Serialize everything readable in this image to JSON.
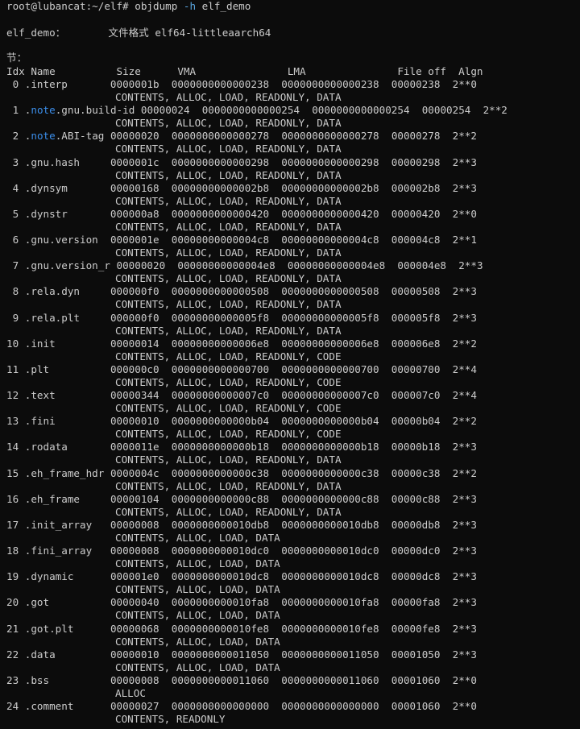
{
  "terminal": {
    "prompt": "root@lubancat:~/elf# ",
    "command": "objdump",
    "flag": "-h",
    "argument": "elf_demo",
    "file_label": "elf_demo：",
    "format_label": "文件格式",
    "format_value": "elf64-littleaarch64",
    "sections_label": "节：",
    "header": {
      "idx": "Idx",
      "name": "Name",
      "size": "Size",
      "vma": "VMA",
      "lma": "LMA",
      "fileoff": "File off",
      "algn": "Algn"
    },
    "rows": [
      {
        "idx": " 0",
        "pre": ".interp",
        "hl": "",
        "post": "",
        "size": "0000001b",
        "vma": "0000000000000238",
        "lma": "0000000000000238",
        "off": "00000238",
        "algn": "2**0",
        "flags": "CONTENTS, ALLOC, LOAD, READONLY, DATA"
      },
      {
        "idx": " 1",
        "pre": ".",
        "hl": "note",
        "post": ".gnu.build-id",
        "size": "00000024",
        "vma": "0000000000000254",
        "lma": "0000000000000254",
        "off": "00000254",
        "algn": "2**2",
        "flags": "CONTENTS, ALLOC, LOAD, READONLY, DATA"
      },
      {
        "idx": " 2",
        "pre": ".",
        "hl": "note",
        "post": ".ABI-tag",
        "size": "00000020",
        "vma": "0000000000000278",
        "lma": "0000000000000278",
        "off": "00000278",
        "algn": "2**2",
        "flags": "CONTENTS, ALLOC, LOAD, READONLY, DATA"
      },
      {
        "idx": " 3",
        "pre": ".gnu.hash",
        "hl": "",
        "post": "",
        "size": "0000001c",
        "vma": "0000000000000298",
        "lma": "0000000000000298",
        "off": "00000298",
        "algn": "2**3",
        "flags": "CONTENTS, ALLOC, LOAD, READONLY, DATA"
      },
      {
        "idx": " 4",
        "pre": ".dynsym",
        "hl": "",
        "post": "",
        "size": "00000168",
        "vma": "00000000000002b8",
        "lma": "00000000000002b8",
        "off": "000002b8",
        "algn": "2**3",
        "flags": "CONTENTS, ALLOC, LOAD, READONLY, DATA"
      },
      {
        "idx": " 5",
        "pre": ".dynstr",
        "hl": "",
        "post": "",
        "size": "000000a8",
        "vma": "0000000000000420",
        "lma": "0000000000000420",
        "off": "00000420",
        "algn": "2**0",
        "flags": "CONTENTS, ALLOC, LOAD, READONLY, DATA"
      },
      {
        "idx": " 6",
        "pre": ".gnu.version",
        "hl": "",
        "post": "",
        "size": "0000001e",
        "vma": "00000000000004c8",
        "lma": "00000000000004c8",
        "off": "000004c8",
        "algn": "2**1",
        "flags": "CONTENTS, ALLOC, LOAD, READONLY, DATA"
      },
      {
        "idx": " 7",
        "pre": ".gnu.version_r",
        "hl": "",
        "post": "",
        "size": "00000020",
        "vma": "00000000000004e8",
        "lma": "00000000000004e8",
        "off": "000004e8",
        "algn": "2**3",
        "flags": "CONTENTS, ALLOC, LOAD, READONLY, DATA"
      },
      {
        "idx": " 8",
        "pre": ".rela.dyn",
        "hl": "",
        "post": "",
        "size": "000000f0",
        "vma": "0000000000000508",
        "lma": "0000000000000508",
        "off": "00000508",
        "algn": "2**3",
        "flags": "CONTENTS, ALLOC, LOAD, READONLY, DATA"
      },
      {
        "idx": " 9",
        "pre": ".rela.plt",
        "hl": "",
        "post": "",
        "size": "000000f0",
        "vma": "00000000000005f8",
        "lma": "00000000000005f8",
        "off": "000005f8",
        "algn": "2**3",
        "flags": "CONTENTS, ALLOC, LOAD, READONLY, DATA"
      },
      {
        "idx": "10",
        "pre": ".init",
        "hl": "",
        "post": "",
        "size": "00000014",
        "vma": "00000000000006e8",
        "lma": "00000000000006e8",
        "off": "000006e8",
        "algn": "2**2",
        "flags": "CONTENTS, ALLOC, LOAD, READONLY, CODE"
      },
      {
        "idx": "11",
        "pre": ".plt",
        "hl": "",
        "post": "",
        "size": "000000c0",
        "vma": "0000000000000700",
        "lma": "0000000000000700",
        "off": "00000700",
        "algn": "2**4",
        "flags": "CONTENTS, ALLOC, LOAD, READONLY, CODE"
      },
      {
        "idx": "12",
        "pre": ".text",
        "hl": "",
        "post": "",
        "size": "00000344",
        "vma": "00000000000007c0",
        "lma": "00000000000007c0",
        "off": "000007c0",
        "algn": "2**4",
        "flags": "CONTENTS, ALLOC, LOAD, READONLY, CODE"
      },
      {
        "idx": "13",
        "pre": ".fini",
        "hl": "",
        "post": "",
        "size": "00000010",
        "vma": "0000000000000b04",
        "lma": "0000000000000b04",
        "off": "00000b04",
        "algn": "2**2",
        "flags": "CONTENTS, ALLOC, LOAD, READONLY, CODE"
      },
      {
        "idx": "14",
        "pre": ".rodata",
        "hl": "",
        "post": "",
        "size": "0000011e",
        "vma": "0000000000000b18",
        "lma": "0000000000000b18",
        "off": "00000b18",
        "algn": "2**3",
        "flags": "CONTENTS, ALLOC, LOAD, READONLY, DATA"
      },
      {
        "idx": "15",
        "pre": ".eh_frame_hdr",
        "hl": "",
        "post": "",
        "size": "0000004c",
        "vma": "0000000000000c38",
        "lma": "0000000000000c38",
        "off": "00000c38",
        "algn": "2**2",
        "flags": "CONTENTS, ALLOC, LOAD, READONLY, DATA"
      },
      {
        "idx": "16",
        "pre": ".eh_frame",
        "hl": "",
        "post": "",
        "size": "00000104",
        "vma": "0000000000000c88",
        "lma": "0000000000000c88",
        "off": "00000c88",
        "algn": "2**3",
        "flags": "CONTENTS, ALLOC, LOAD, READONLY, DATA"
      },
      {
        "idx": "17",
        "pre": ".init_array",
        "hl": "",
        "post": "",
        "size": "00000008",
        "vma": "0000000000010db8",
        "lma": "0000000000010db8",
        "off": "00000db8",
        "algn": "2**3",
        "flags": "CONTENTS, ALLOC, LOAD, DATA"
      },
      {
        "idx": "18",
        "pre": ".fini_array",
        "hl": "",
        "post": "",
        "size": "00000008",
        "vma": "0000000000010dc0",
        "lma": "0000000000010dc0",
        "off": "00000dc0",
        "algn": "2**3",
        "flags": "CONTENTS, ALLOC, LOAD, DATA"
      },
      {
        "idx": "19",
        "pre": ".dynamic",
        "hl": "",
        "post": "",
        "size": "000001e0",
        "vma": "0000000000010dc8",
        "lma": "0000000000010dc8",
        "off": "00000dc8",
        "algn": "2**3",
        "flags": "CONTENTS, ALLOC, LOAD, DATA"
      },
      {
        "idx": "20",
        "pre": ".got",
        "hl": "",
        "post": "",
        "size": "00000040",
        "vma": "0000000000010fa8",
        "lma": "0000000000010fa8",
        "off": "00000fa8",
        "algn": "2**3",
        "flags": "CONTENTS, ALLOC, LOAD, DATA"
      },
      {
        "idx": "21",
        "pre": ".got.plt",
        "hl": "",
        "post": "",
        "size": "00000068",
        "vma": "0000000000010fe8",
        "lma": "0000000000010fe8",
        "off": "00000fe8",
        "algn": "2**3",
        "flags": "CONTENTS, ALLOC, LOAD, DATA"
      },
      {
        "idx": "22",
        "pre": ".data",
        "hl": "",
        "post": "",
        "size": "00000010",
        "vma": "0000000000011050",
        "lma": "0000000000011050",
        "off": "00001050",
        "algn": "2**3",
        "flags": "CONTENTS, ALLOC, LOAD, DATA"
      },
      {
        "idx": "23",
        "pre": ".bss",
        "hl": "",
        "post": "",
        "size": "00000008",
        "vma": "0000000000011060",
        "lma": "0000000000011060",
        "off": "00001060",
        "algn": "2**0",
        "flags": "ALLOC"
      },
      {
        "idx": "24",
        "pre": ".comment",
        "hl": "",
        "post": "",
        "size": "00000027",
        "vma": "0000000000000000",
        "lma": "0000000000000000",
        "off": "00001060",
        "algn": "2**0",
        "flags": "CONTENTS, READONLY"
      }
    ]
  },
  "colors": {
    "background": "#0c0c0c",
    "foreground": "#cccccc",
    "flag": "#5aa6e0",
    "highlight": "#3b8eea"
  }
}
